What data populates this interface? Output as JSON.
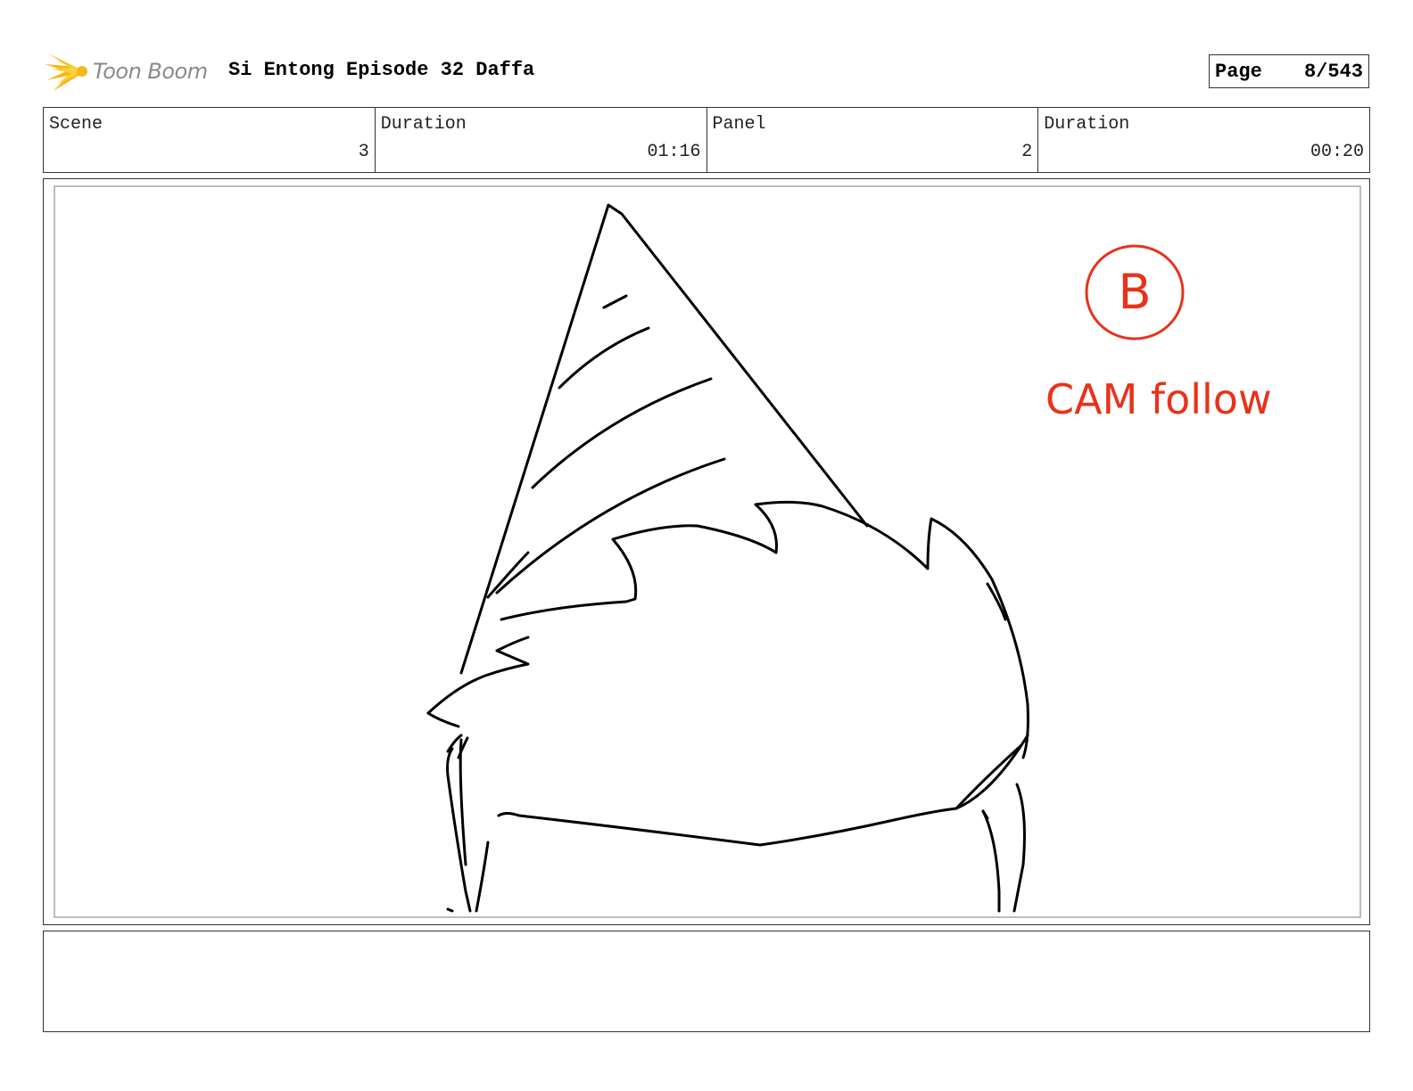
{
  "header": {
    "logo_text": "Toon Boom",
    "project_title": "Si Entong Episode 32 Daffa",
    "page_label": "Page",
    "page_value": "8/543"
  },
  "info": {
    "scene_label": "Scene",
    "scene_value": "3",
    "scene_duration_label": "Duration",
    "scene_duration_value": "01:16",
    "panel_label": "Panel",
    "panel_value": "2",
    "panel_duration_label": "Duration",
    "panel_duration_value": "00:20"
  },
  "panel": {
    "annotation_mark": "B",
    "annotation_text": "CAM follow",
    "annotation_color": "#e8321a",
    "sketch_color": "#000000"
  },
  "notes": {
    "text": ""
  }
}
